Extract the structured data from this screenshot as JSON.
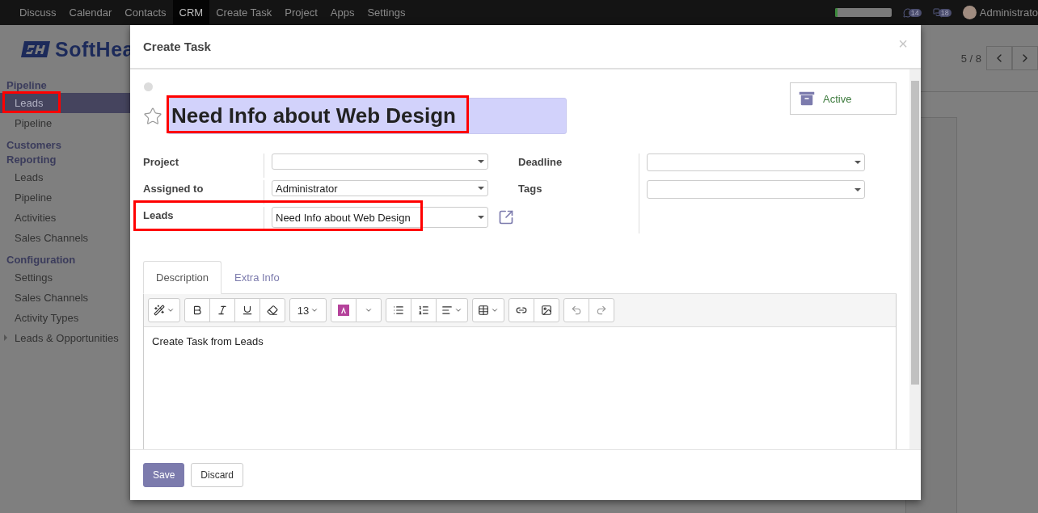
{
  "nav": {
    "items": [
      {
        "label": "Discuss",
        "selected": false
      },
      {
        "label": "Calendar",
        "selected": false
      },
      {
        "label": "Contacts",
        "selected": false
      },
      {
        "label": "CRM",
        "selected": true
      },
      {
        "label": "Create Task",
        "selected": false
      },
      {
        "label": "Project",
        "selected": false
      },
      {
        "label": "Apps",
        "selected": false
      },
      {
        "label": "Settings",
        "selected": false
      }
    ],
    "status_bar": {
      "level": 0.05
    },
    "activity_count": "14",
    "message_count": "18",
    "user": "Administrato"
  },
  "logo": {
    "text": "SoftHea"
  },
  "sidebar": {
    "sections": [
      {
        "title": "Pipeline",
        "items": [
          {
            "label": "Leads",
            "selected": true,
            "highlighted": true,
            "kind": "link"
          },
          {
            "label": "Pipeline",
            "selected": false,
            "highlighted": false,
            "kind": "link"
          }
        ]
      },
      {
        "title": "Customers Reporting",
        "items": [
          {
            "label": "Leads",
            "selected": false,
            "highlighted": false,
            "kind": "link"
          },
          {
            "label": "Pipeline",
            "selected": false,
            "highlighted": false,
            "kind": "link"
          },
          {
            "label": "Activities",
            "selected": false,
            "highlighted": false,
            "kind": "link"
          },
          {
            "label": "Sales Channels",
            "selected": false,
            "highlighted": false,
            "kind": "link"
          }
        ]
      },
      {
        "title": "Configuration",
        "items": [
          {
            "label": "Settings",
            "selected": false,
            "highlighted": false,
            "kind": "link"
          },
          {
            "label": "Sales Channels",
            "selected": false,
            "highlighted": false,
            "kind": "link"
          },
          {
            "label": "Activity Types",
            "selected": false,
            "highlighted": false,
            "kind": "link"
          },
          {
            "label": "Leads & Opportunities",
            "selected": false,
            "highlighted": false,
            "kind": "folder",
            "expanded": false
          }
        ]
      }
    ]
  },
  "pager": "5 / 8",
  "dialog": {
    "title": "Create Task",
    "close": "×",
    "starred": false,
    "name": "Need Info about Web Design",
    "name_highlighted": true,
    "active_label": "Active",
    "fields_left": [
      {
        "label": "Project",
        "highlighted": false,
        "open_link": false
      },
      {
        "label": "Assigned to",
        "value": "Administrator",
        "highlighted": false,
        "open_link": false
      },
      {
        "label": "Leads",
        "value": "Need Info about Web Design",
        "highlighted": true,
        "open_link": true
      }
    ],
    "fields_right": [
      {
        "label": "Deadline"
      },
      {
        "label": "Tags"
      }
    ],
    "tabs": [
      {
        "label": "Description",
        "selected": true
      },
      {
        "label": "Extra Info",
        "selected": false
      }
    ],
    "font_size": "13",
    "content": "Create Task from Leads",
    "buttons": [
      {
        "label": "Save",
        "kind": "primary"
      },
      {
        "label": "Discard",
        "kind": "secondary"
      }
    ]
  }
}
